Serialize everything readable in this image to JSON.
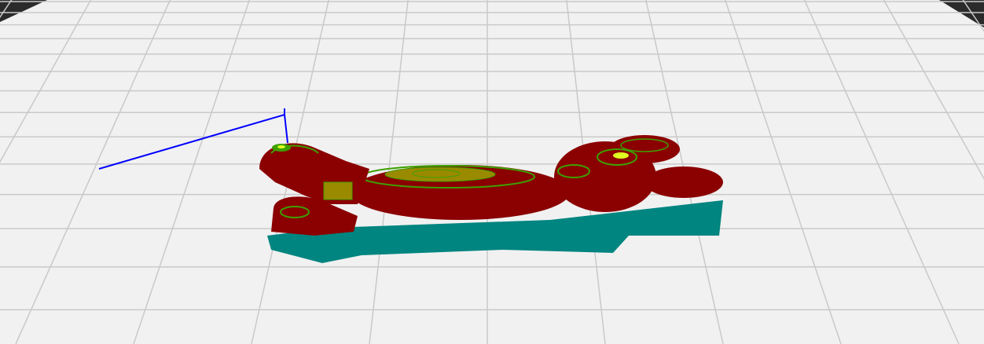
{
  "viewer": {
    "mode": "preview-3d",
    "colors": {
      "bed": "#f1f1f1",
      "grid": "#c8c8c8",
      "background_corner": "#2a2a2a",
      "model_body": "#8b0000",
      "contour_line": "#3da000",
      "top_surface": "#9a8a00",
      "highlight": "#e0ff20",
      "support": "#008580",
      "travel": "#0000ff"
    }
  }
}
